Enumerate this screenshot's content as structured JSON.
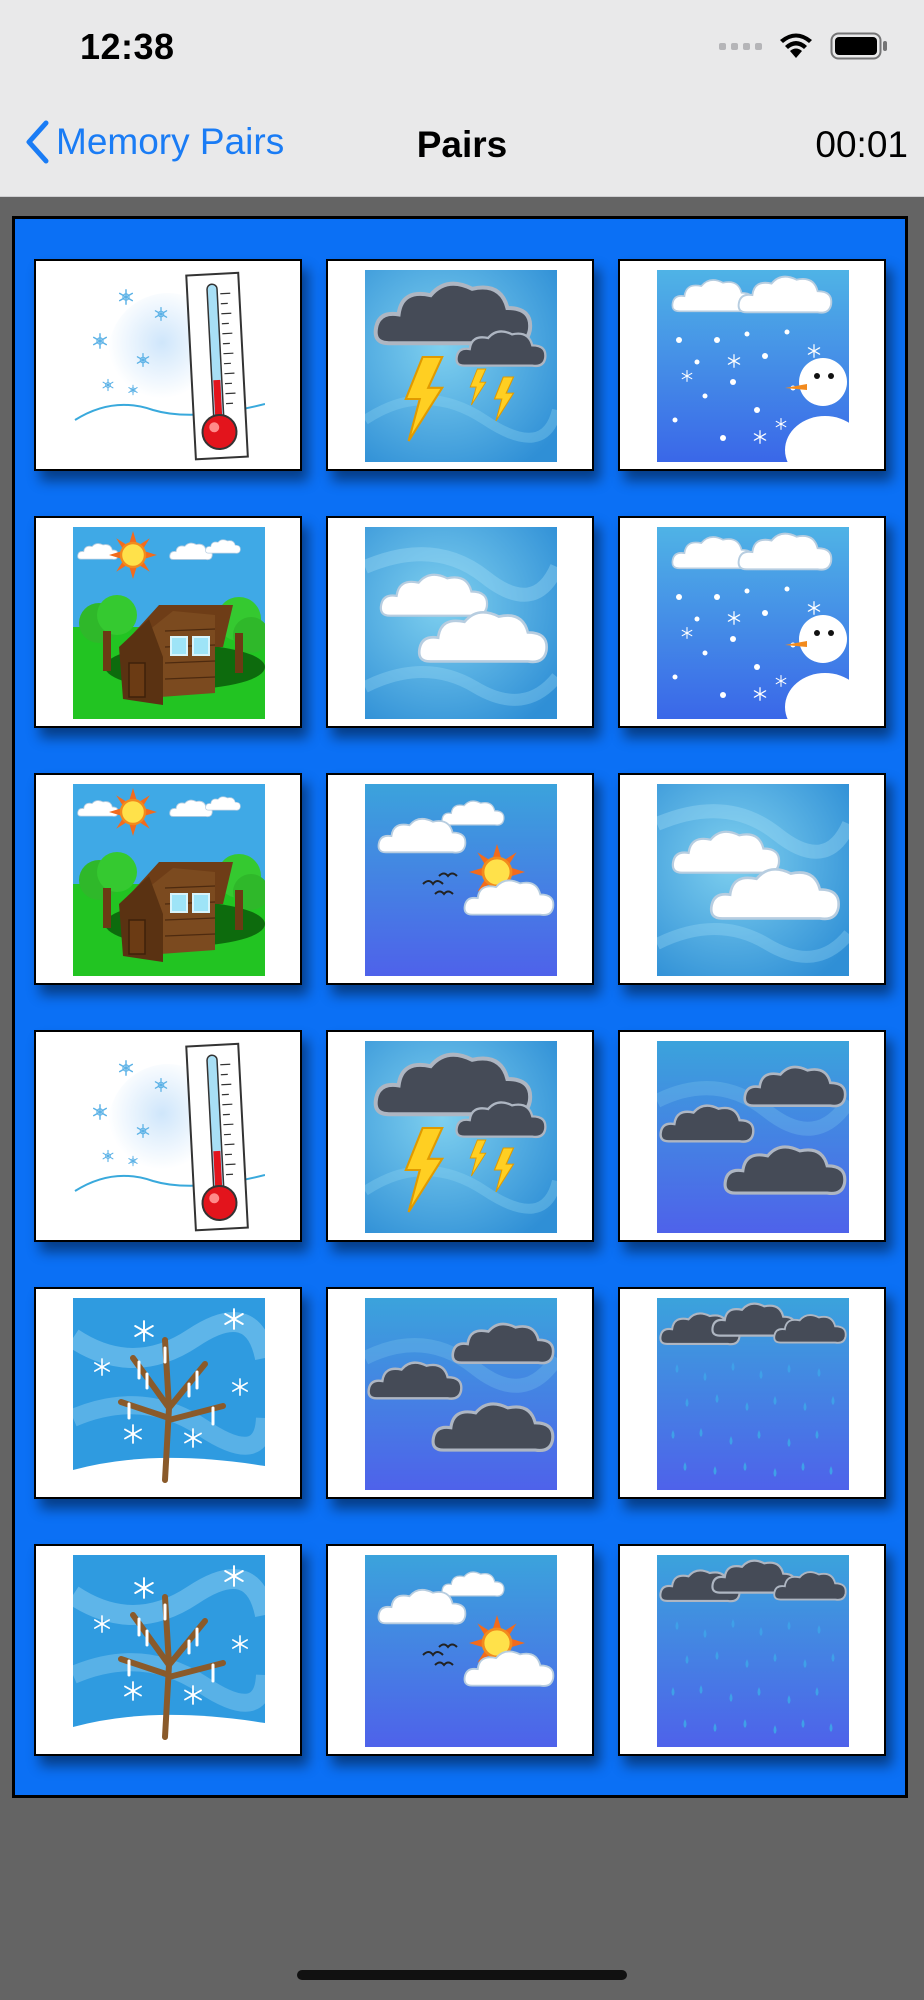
{
  "status_bar": {
    "time": "12:38"
  },
  "nav": {
    "back_label": "Memory Pairs",
    "title": "Pairs",
    "timer": "00:01"
  },
  "cards": [
    {
      "image": "thermometer-cold"
    },
    {
      "image": "thunderstorm"
    },
    {
      "image": "snowman-snow"
    },
    {
      "image": "sunny-house"
    },
    {
      "image": "white-clouds"
    },
    {
      "image": "snowman-snow"
    },
    {
      "image": "sunny-house"
    },
    {
      "image": "partly-cloudy-birds"
    },
    {
      "image": "white-clouds"
    },
    {
      "image": "thermometer-cold"
    },
    {
      "image": "thunderstorm"
    },
    {
      "image": "dark-clouds"
    },
    {
      "image": "frozen-tree"
    },
    {
      "image": "dark-clouds"
    },
    {
      "image": "rain-clouds"
    },
    {
      "image": "frozen-tree"
    },
    {
      "image": "partly-cloudy-birds"
    },
    {
      "image": "rain-clouds"
    }
  ]
}
